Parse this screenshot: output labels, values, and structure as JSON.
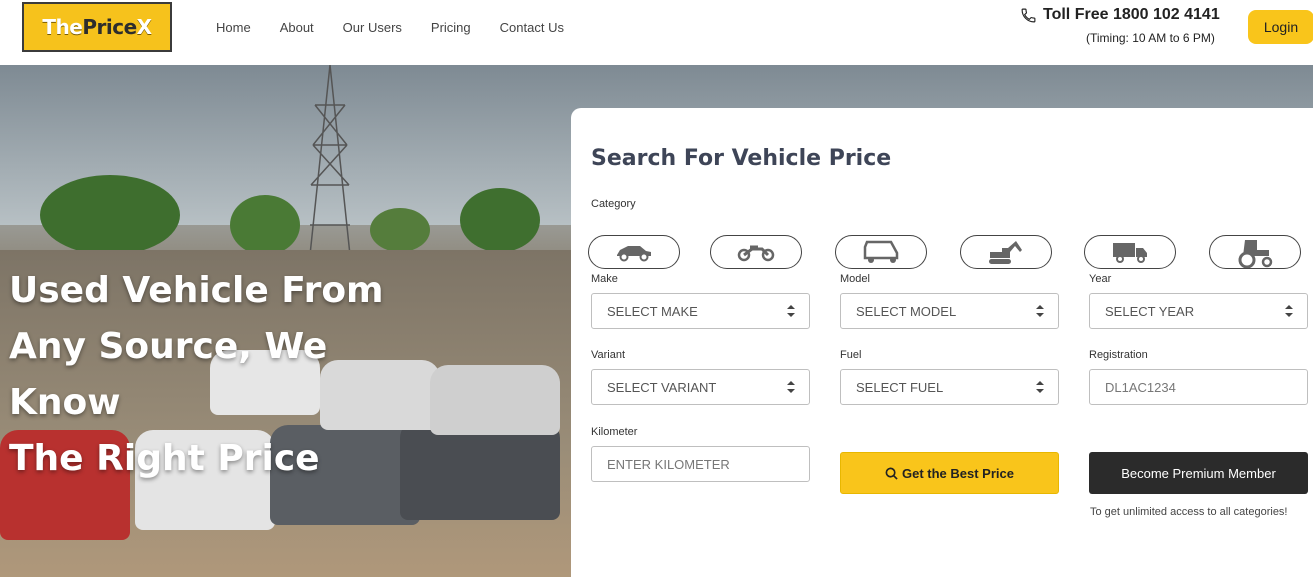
{
  "header": {
    "logo": {
      "part1": "The",
      "part2": "Price",
      "part3": "X"
    },
    "nav": [
      "Home",
      "About",
      "Our Users",
      "Pricing",
      "Contact Us"
    ],
    "toll_free": "Toll Free 1800 102 4141",
    "timing": "(Timing: 10 AM to 6 PM)",
    "login_label": "Login"
  },
  "hero": {
    "title_lines": [
      "Used Vehicle From",
      "Any Source, We Know",
      "The Right Price"
    ]
  },
  "search": {
    "title": "Search For Vehicle Price",
    "category_label": "Category",
    "categories": [
      "car-icon",
      "motorcycle-icon",
      "auto-rickshaw-icon",
      "excavator-icon",
      "truck-icon",
      "tractor-icon"
    ],
    "make": {
      "label": "Make",
      "value": "SELECT MAKE"
    },
    "model": {
      "label": "Model",
      "value": "SELECT MODEL"
    },
    "year": {
      "label": "Year",
      "value": "SELECT YEAR"
    },
    "variant": {
      "label": "Variant",
      "value": "SELECT VARIANT"
    },
    "fuel": {
      "label": "Fuel",
      "value": "SELECT FUEL"
    },
    "registration": {
      "label": "Registration",
      "placeholder": "DL1AC1234"
    },
    "kilometer": {
      "label": "Kilometer",
      "placeholder": "ENTER KILOMETER"
    },
    "get_price_label": "Get the Best Price",
    "premium_label": "Become Premium Member",
    "premium_note": "To get unlimited access to all categories!"
  },
  "colors": {
    "accent": "#f9c51b",
    "dark": "#2b2b2b",
    "title": "#3e4557"
  }
}
